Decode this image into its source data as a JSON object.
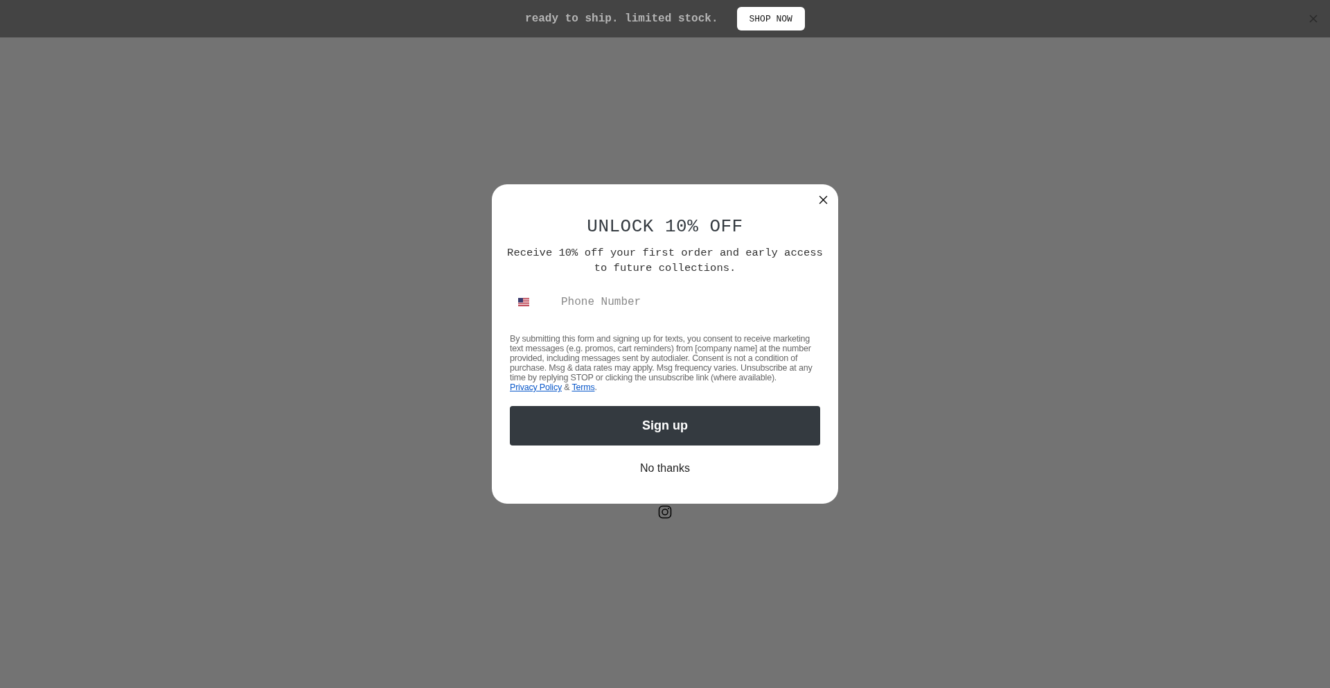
{
  "announcement_bar": {
    "text": "ready to ship. limited stock.",
    "button": "SHOP NOW"
  },
  "popup": {
    "title": "UNLOCK 10% OFF",
    "subtitle": "Receive 10% off your first order and early access to future collections.",
    "phone_field": {
      "placeholder": "Phone Number"
    },
    "legal": {
      "text": "By submitting this form and signing up for texts, you consent to receive marketing text messages (e.g. promos, cart reminders) from [company name] at the number provided, including messages sent by autodialer. Consent is not a condition of purchase. Msg & data rates may apply. Msg frequency varies. Unsubscribe at any time by replying STOP or clicking the unsubscribe link (where available).",
      "links": [
        "Privacy Policy",
        "Terms"
      ],
      "joiner": "&",
      "end": "."
    },
    "primary_button": "Sign up",
    "secondary_button": "No thanks"
  }
}
